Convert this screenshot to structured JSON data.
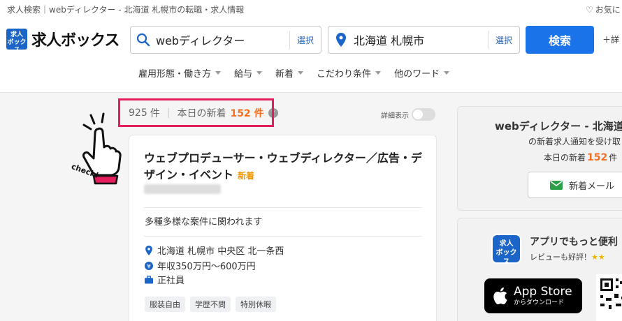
{
  "header": {
    "breadcrumb": "求人検索｜webディレクター - 北海道 札幌市の転職・求人情報",
    "favorite_label": "お気に",
    "logo_mark": "求人ボックス",
    "logo_text": "求人ボックス",
    "keyword": {
      "value": "webディレクター",
      "select_label": "選択"
    },
    "location": {
      "value": "北海道 札幌市",
      "select_label": "選択"
    },
    "search_button": "検索",
    "more_conditions": "＋詳"
  },
  "filters": [
    {
      "label": "雇用形態・働き方"
    },
    {
      "label": "給与"
    },
    {
      "label": "新着"
    },
    {
      "label": "こだわり条件"
    },
    {
      "label": "他のワード"
    }
  ],
  "results": {
    "total": "925",
    "total_unit": "件",
    "today_new_label": "本日の新着",
    "today_new_count": "152 件",
    "help": "?",
    "detail_toggle_label": "詳細表示",
    "check_label": "check!"
  },
  "job": {
    "title": "ウェブプロデューサー・ウェブディレクター／広告・デザイン・イベント",
    "new_badge": "新着",
    "catch": "多種多様な案件に関われます",
    "location": "北海道 札幌市 中央区 北一条西",
    "salary": "年収350万円〜600万円",
    "employment": "正社員",
    "tags": [
      "服装自由",
      "学歴不問",
      "特別休暇"
    ]
  },
  "sidebar": {
    "title": "webディレクター - 北海道",
    "subtitle": "の新着求人通知を受け取",
    "today_label": "本日の新着",
    "today_count": "152",
    "today_unit": "件",
    "mail_button": "新着メール"
  },
  "app_promo": {
    "logo": "求人ボックス",
    "title": "アプリでもっと便利",
    "subtitle": "レビューも好評！",
    "stars": "★★",
    "store_main": "App Store",
    "store_sub": "からダウンロード"
  },
  "colors": {
    "brand_blue": "#1b64c8",
    "search_button": "#1a73e8",
    "new_orange": "#f36f21",
    "highlight_pink": "#e41e5c"
  }
}
